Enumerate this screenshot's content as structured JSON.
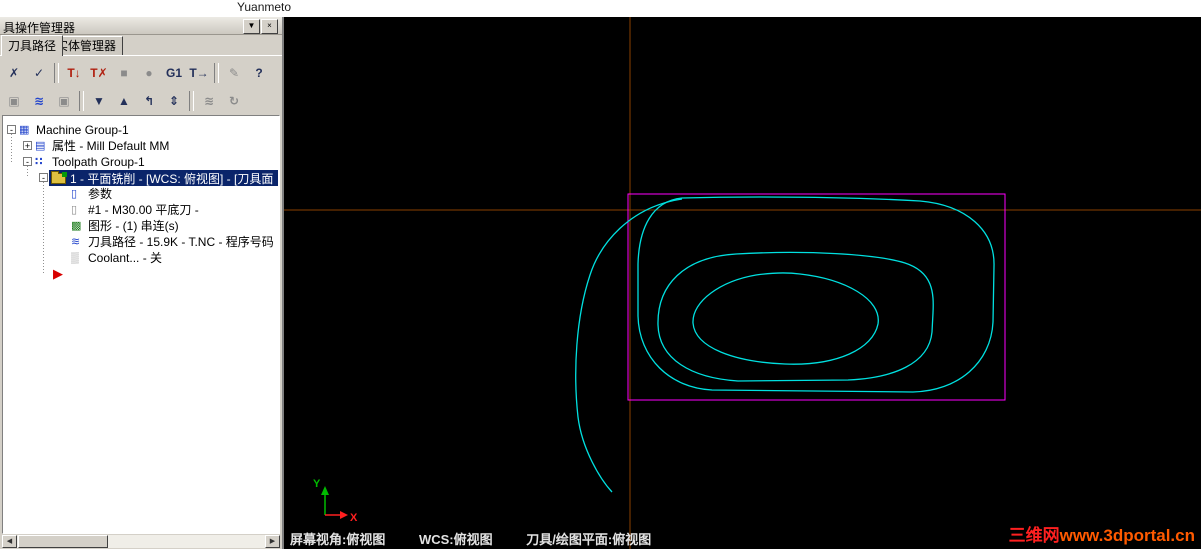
{
  "page": {
    "top_text": "Yuanmeto"
  },
  "panel": {
    "title": "具操作管理器",
    "caption_buttons": {
      "dropdown_glyph": "▼",
      "close_glyph": "×"
    },
    "tabs": [
      {
        "label": "刀具路径"
      },
      {
        "label": "实体管理器"
      }
    ],
    "toolbar_row1": [
      {
        "name": "select-x-icon",
        "glyph": "✗"
      },
      {
        "name": "select-check-icon",
        "glyph": "✓"
      },
      {
        "name": "t-down-icon",
        "glyph": "T↓"
      },
      {
        "name": "t-x-icon",
        "glyph": "T✗"
      },
      {
        "name": "square-icon",
        "glyph": "■"
      },
      {
        "name": "circle-icon",
        "glyph": "●"
      },
      {
        "name": "g1-icon",
        "glyph": "G1"
      },
      {
        "name": "t-arrow-icon",
        "glyph": "T→"
      },
      {
        "name": "pencil-icon",
        "glyph": "✎"
      },
      {
        "name": "help-icon",
        "glyph": "?"
      }
    ],
    "toolbar_row2": [
      {
        "name": "lock-icon",
        "glyph": "▣"
      },
      {
        "name": "toolpath-waves-icon",
        "glyph": "≋"
      },
      {
        "name": "clipboard-icon",
        "glyph": "▣"
      },
      {
        "name": "move-down-icon",
        "glyph": "▼"
      },
      {
        "name": "move-up-icon",
        "glyph": "▲"
      },
      {
        "name": "insert-up-icon",
        "glyph": "↰"
      },
      {
        "name": "scroll-updown-icon",
        "glyph": "⇕"
      },
      {
        "name": "ghost-waves-icon",
        "glyph": "≋"
      },
      {
        "name": "regen-icon",
        "glyph": "↻"
      }
    ],
    "tree": {
      "items": [
        {
          "label": "Machine Group-1",
          "expander": "-",
          "glyph": "▦"
        },
        {
          "label": "属性 - Mill Default MM",
          "expander": "+",
          "glyph": "▤"
        },
        {
          "label": "Toolpath Group-1",
          "expander": "-",
          "glyph": "∷"
        },
        {
          "label": "1 - 平面铣削 - [WCS: 俯视图] - [刀具面",
          "expander": "-",
          "glyph": ""
        },
        {
          "label": "参数",
          "glyph": "▯"
        },
        {
          "label": "#1 - M30.00 平底刀 -",
          "glyph": "▯"
        },
        {
          "label": "图形 - (1) 串连(s)",
          "glyph": "▩"
        },
        {
          "label": "刀具路径 - 15.9K - T.NC - 程序号码",
          "glyph": "≋"
        },
        {
          "label": "Coolant... - 关",
          "glyph": "▒"
        }
      ],
      "insert_arrow_glyph": "▶"
    },
    "scrollbar": {
      "left_glyph": "◀",
      "right_glyph": "▶"
    }
  },
  "viewport": {
    "status": {
      "screen_view": "屏幕视角:俯视图",
      "wcs": "WCS:俯视图",
      "cplane": "刀具/绘图平面:俯视图"
    },
    "axis": {
      "x": "X",
      "y": "Y"
    },
    "watermark": {
      "site": "三维网",
      "url": "www.3dportal.cn"
    },
    "colors": {
      "background": "#000000",
      "crosshair": "#8a4000",
      "boundary": "#ff00ff",
      "toolpath": "#00e0e0",
      "axis_x": "#ff2020",
      "axis_y": "#00bb00"
    }
  }
}
